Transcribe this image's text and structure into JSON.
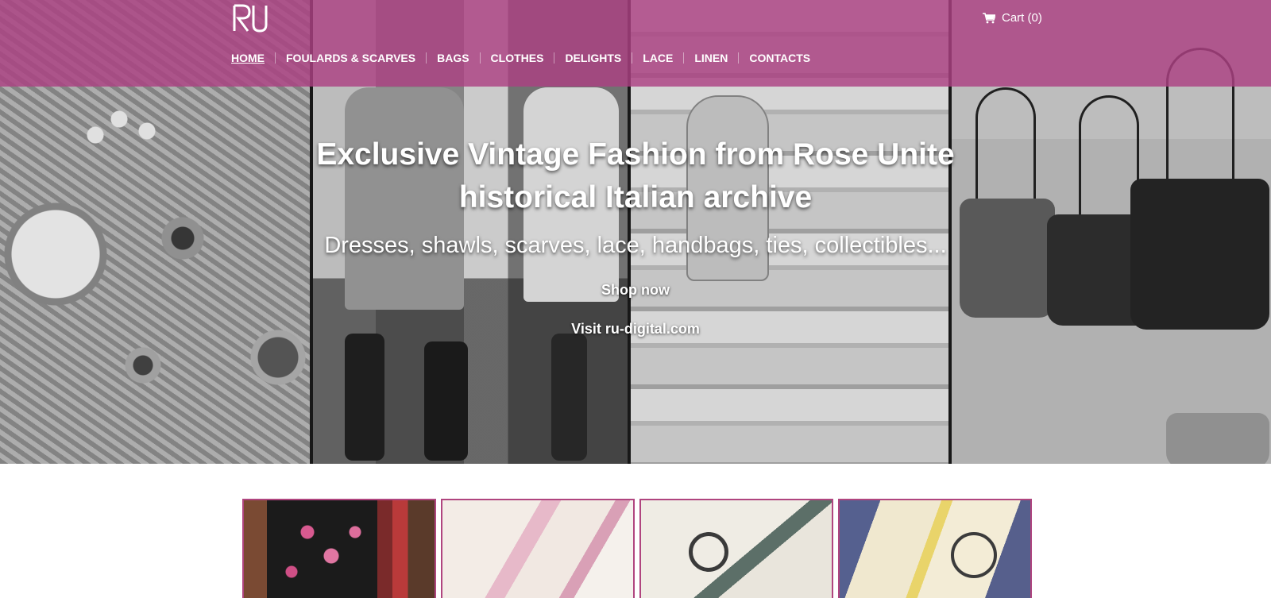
{
  "brand": {
    "logo_text": "RU"
  },
  "header": {
    "cart_label": "Cart (0)",
    "cart_icon": "shopping-cart-icon",
    "nav": [
      {
        "label": "HOME",
        "active": true
      },
      {
        "label": "FOULARDS & SCARVES"
      },
      {
        "label": "BAGS"
      },
      {
        "label": "CLOTHES"
      },
      {
        "label": "DELIGHTS"
      },
      {
        "label": "LACE"
      },
      {
        "label": "LINEN"
      },
      {
        "label": "CONTACTS"
      }
    ],
    "color": "#ac4182"
  },
  "hero": {
    "headline": "Exclusive Vintage Fashion from Rose Unite historical Italian archive",
    "subline": "Dresses, shawls, scarves, lace, handbags, ties, collectibles...",
    "shop_now": "Shop now",
    "visit": "Visit ru-digital.com"
  },
  "accent_color": "#b0457f"
}
